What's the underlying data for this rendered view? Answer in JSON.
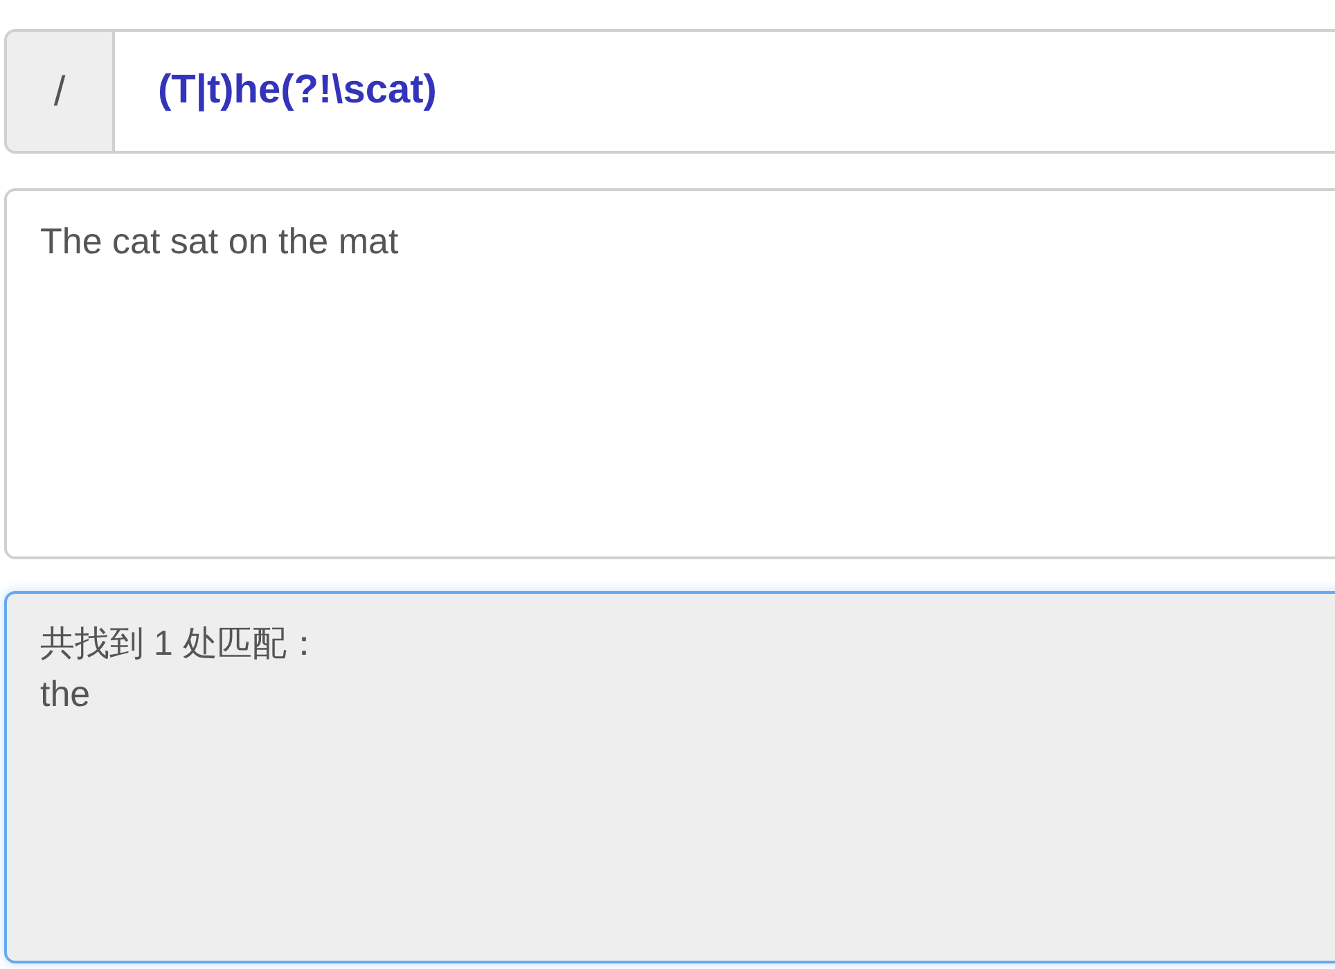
{
  "regex": {
    "delimiter": "/",
    "pattern": "(T|t)he(?!\\scat)"
  },
  "test_string": {
    "value": "The cat sat on the mat"
  },
  "result": {
    "summary": "共找到 1 处匹配：",
    "matches": [
      "the"
    ]
  }
}
